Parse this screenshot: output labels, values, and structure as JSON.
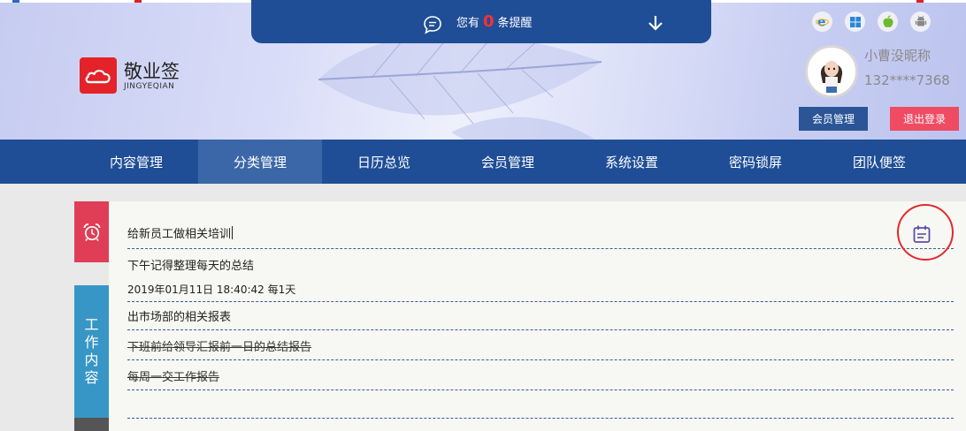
{
  "header": {
    "reminder": {
      "prefix": "您有",
      "count": "0",
      "suffix": "条提醒"
    },
    "os_icons": [
      "ie-icon",
      "windows-icon",
      "apple-icon",
      "android-icon"
    ]
  },
  "logo": {
    "cn": "敬业签",
    "en": "JINGYEQIAN"
  },
  "user": {
    "nickname": "小曹没昵称",
    "phone": "132****7368",
    "member_button": "会员管理",
    "logout_button": "退出登录"
  },
  "nav": {
    "items": [
      "内容管理",
      "分类管理",
      "日历总览",
      "会员管理",
      "系统设置",
      "密码锁屏",
      "团队便签"
    ],
    "active": "分类管理"
  },
  "side": {
    "work_label": [
      "工",
      "作",
      "内",
      "容"
    ]
  },
  "notes": {
    "input_value": "给新员工做相关培训",
    "items": [
      {
        "text": "下午记得整理每天的总结",
        "meta": "2019年01月11日 18:40:42 每1天"
      },
      {
        "text": "出市场部的相关报表"
      },
      {
        "text": "下班前给领导汇报前一日的总结报告",
        "done": true
      },
      {
        "text": "每周一交工作报告",
        "done": true
      }
    ]
  },
  "colors": {
    "nav_blue": "#1f4e96",
    "nav_active": "#3b67a8",
    "alarm_red": "#df3e56",
    "work_blue": "#3896c6",
    "logout_pink": "#ef4b63",
    "highlight_ring": "#e02b2b"
  }
}
